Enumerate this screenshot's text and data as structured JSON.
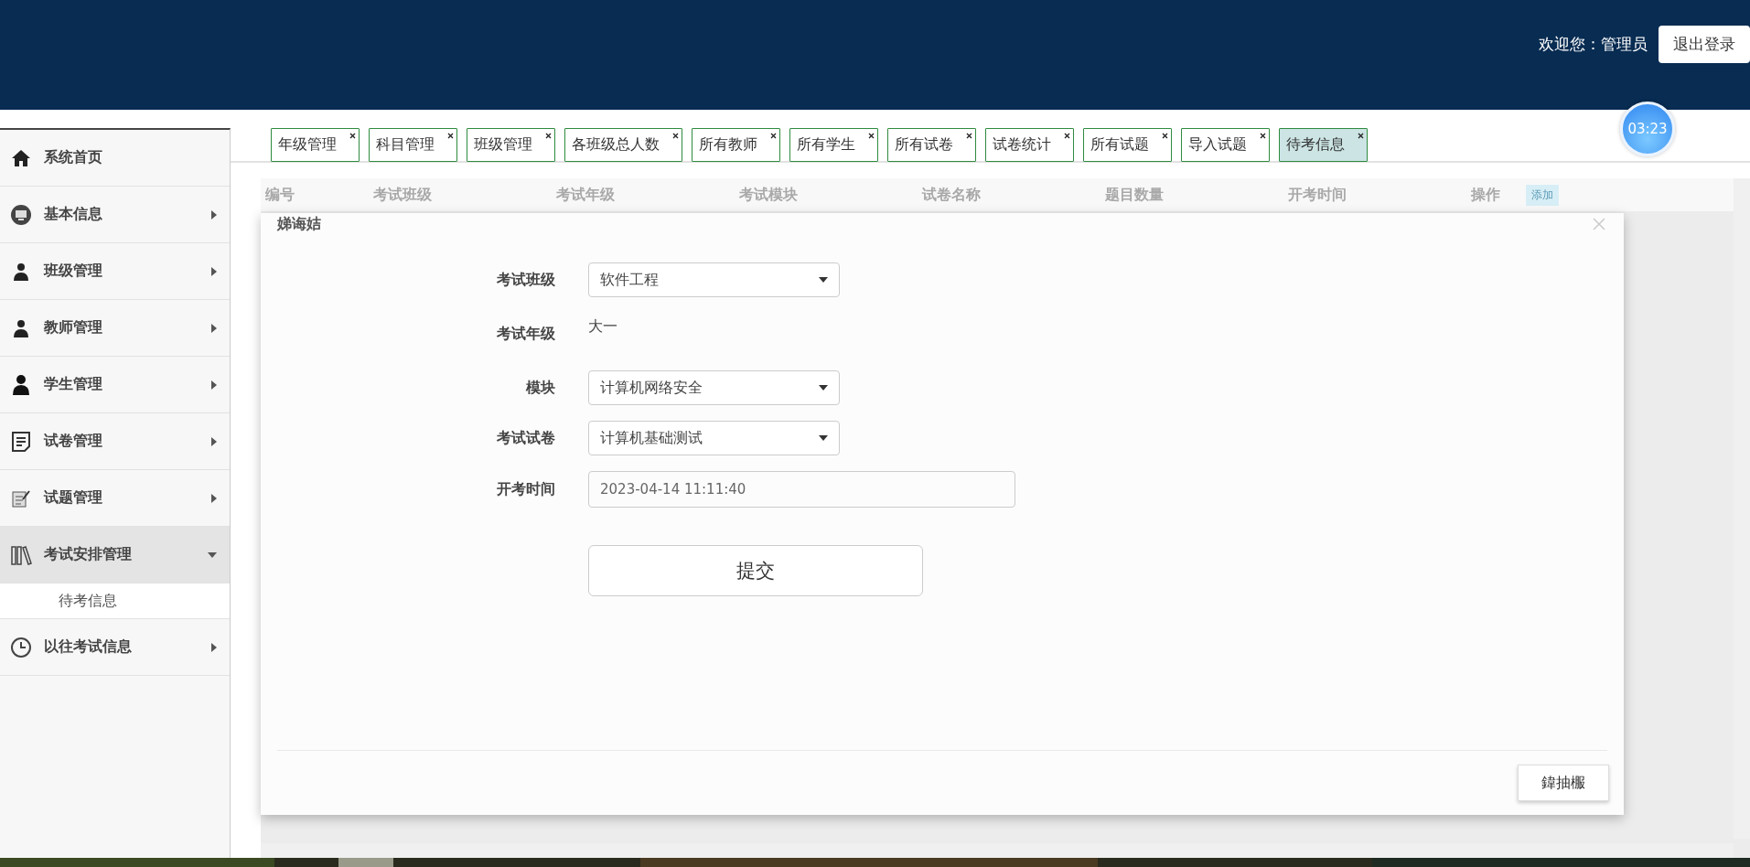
{
  "header": {
    "welcome": "欢迎您：管理员",
    "logout": "退出登录"
  },
  "timer": "03:23",
  "sidebar": {
    "items": [
      {
        "label": "系统首页",
        "kind": "link"
      },
      {
        "label": "基本信息",
        "kind": "menu",
        "expanded": false
      },
      {
        "label": "班级管理",
        "kind": "menu",
        "expanded": false
      },
      {
        "label": "教师管理",
        "kind": "menu",
        "expanded": false
      },
      {
        "label": "学生管理",
        "kind": "menu",
        "expanded": false
      },
      {
        "label": "试卷管理",
        "kind": "menu",
        "expanded": false
      },
      {
        "label": "试题管理",
        "kind": "menu",
        "expanded": false
      },
      {
        "label": "考试安排管理",
        "kind": "menu",
        "expanded": true,
        "children": [
          {
            "label": "待考信息"
          }
        ]
      },
      {
        "label": "以往考试信息",
        "kind": "menu",
        "expanded": false
      }
    ]
  },
  "tabs": [
    {
      "label": "年级管理",
      "selected": false
    },
    {
      "label": "科目管理",
      "selected": false
    },
    {
      "label": "班级管理",
      "selected": false
    },
    {
      "label": "各班级总人数",
      "selected": false
    },
    {
      "label": "所有教师",
      "selected": false
    },
    {
      "label": "所有学生",
      "selected": false
    },
    {
      "label": "所有试卷",
      "selected": false
    },
    {
      "label": "试卷统计",
      "selected": false
    },
    {
      "label": "所有试题",
      "selected": false
    },
    {
      "label": "导入试题",
      "selected": false
    },
    {
      "label": "待考信息",
      "selected": true
    }
  ],
  "table": {
    "columns": [
      "编号",
      "考试班级",
      "考试年级",
      "考试模块",
      "试卷名称",
      "题目数量",
      "开考时间",
      "操作"
    ],
    "add_button": "添加"
  },
  "dialog": {
    "title": "娣诲姞",
    "fields": [
      {
        "label": "考试班级",
        "kind": "select",
        "value": "软件工程"
      },
      {
        "label": "考试年级",
        "kind": "text",
        "value": "大一"
      },
      {
        "label": "模块",
        "kind": "select",
        "value": "计算机网络安全"
      },
      {
        "label": "考试试卷",
        "kind": "select",
        "value": "计算机基础测试"
      },
      {
        "label": "开考时间",
        "kind": "input",
        "value": "2023-04-14 11:11:40"
      }
    ],
    "submit": "提交",
    "close": "鍏抽棴"
  }
}
